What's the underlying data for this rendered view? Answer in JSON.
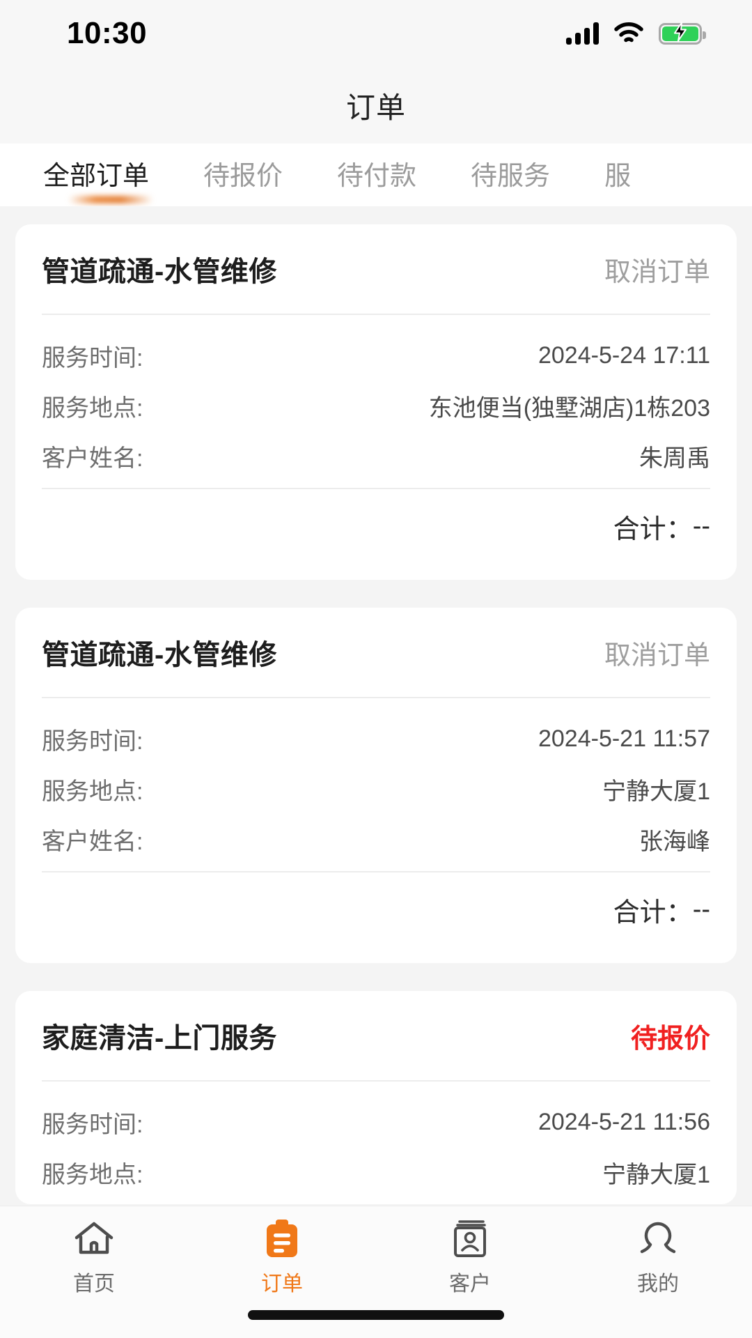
{
  "status_bar": {
    "time": "10:30",
    "signal_icon": "signal-bars-icon",
    "wifi_icon": "wifi-icon",
    "battery_icon": "battery-charging-icon"
  },
  "header": {
    "title": "订单"
  },
  "tabs": {
    "active_index": 0,
    "items": [
      {
        "label": "全部订单"
      },
      {
        "label": "待报价"
      },
      {
        "label": "待付款"
      },
      {
        "label": "待服务"
      },
      {
        "label": "服"
      }
    ]
  },
  "labels": {
    "service_time": "服务时间:",
    "service_location": "服务地点:",
    "customer_name": "客户姓名:",
    "total": "合计："
  },
  "orders": [
    {
      "title": "管道疏通-水管维修",
      "status": "取消订单",
      "status_type": "cancelled",
      "service_time": "2024-5-24 17:11",
      "service_location": "东池便当(独墅湖店)1栋203",
      "customer_name": "朱周禹",
      "total_value": "--"
    },
    {
      "title": "管道疏通-水管维修",
      "status": "取消订单",
      "status_type": "cancelled",
      "service_time": "2024-5-21 11:57",
      "service_location": "宁静大厦1",
      "customer_name": "张海峰",
      "total_value": "--"
    },
    {
      "title": "家庭清洁-上门服务",
      "status": "待报价",
      "status_type": "pending",
      "service_time": "2024-5-21 11:56",
      "service_location": "宁静大厦1",
      "customer_name": "",
      "total_value": ""
    }
  ],
  "bottom_nav": {
    "active_index": 1,
    "items": [
      {
        "label": "首页",
        "icon": "home-icon"
      },
      {
        "label": "订单",
        "icon": "clipboard-icon"
      },
      {
        "label": "客户",
        "icon": "contact-book-icon"
      },
      {
        "label": "我的",
        "icon": "person-icon"
      }
    ]
  },
  "colors": {
    "accent": "#f07818",
    "pending": "#f02020",
    "muted": "#9e9e9e",
    "page_bg": "#f4f4f4"
  }
}
